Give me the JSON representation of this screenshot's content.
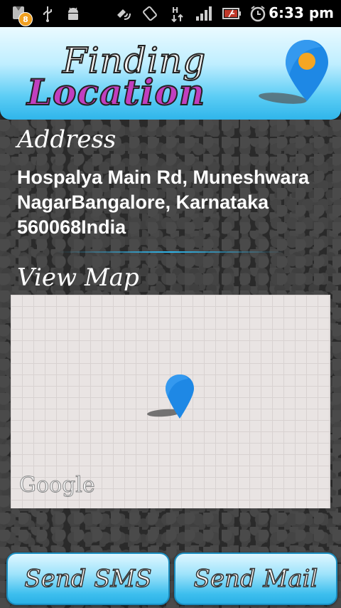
{
  "status_bar": {
    "notification_count": "8",
    "time": "6:33 pm",
    "icons": [
      "notification-icon",
      "usb-icon",
      "android-debug-icon",
      "gps-icon",
      "screen-rotate-icon",
      "data-transfer-icon",
      "signal-icon",
      "battery-icon",
      "alarm-icon"
    ]
  },
  "header": {
    "title_line1": "Finding",
    "title_line2": "Location",
    "logo_icon": "location-pin-icon"
  },
  "address": {
    "label": "Address",
    "text": "Hospalya Main Rd, Muneshwara NagarBangalore, Karnataka 560068India"
  },
  "map": {
    "label": "View Map",
    "provider_logo": "Google",
    "marker_icon": "map-marker-icon"
  },
  "buttons": {
    "send_sms": "Send SMS",
    "send_mail": "Send Mail"
  },
  "colors": {
    "accent": "#2fb5ea",
    "title_location": "#c13fbf",
    "pin": "#1e88e5",
    "pin_center": "#f5a623"
  }
}
